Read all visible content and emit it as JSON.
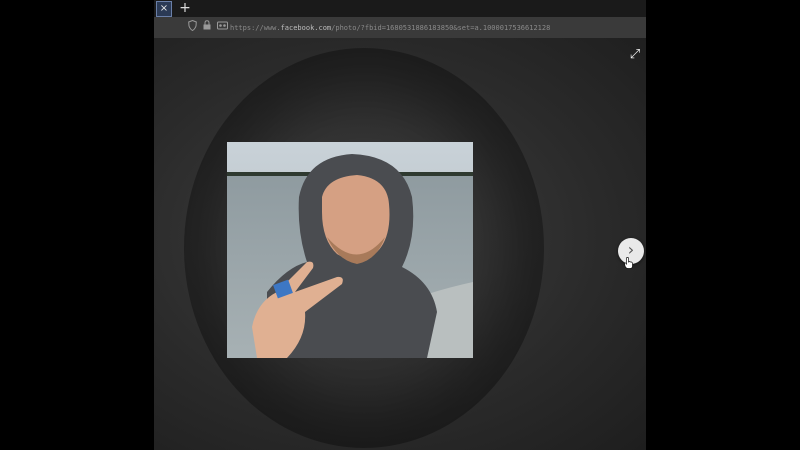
{
  "browser": {
    "tab": {
      "close_glyph": "×"
    },
    "new_tab_glyph": "+",
    "address_bar": {
      "url_prefix": "https://www.",
      "url_host": "facebook.com",
      "url_rest": "/photo/?fbid=1680531886183850&set=a.1000017536612128"
    },
    "icons": [
      "shield-icon",
      "lock-icon",
      "tracking-icon"
    ]
  },
  "viewer": {
    "expand_glyph": "⤢",
    "next_glyph": "›"
  },
  "colors": {
    "page_background": "#000000",
    "viewer_background": "#2c2c2c",
    "next_button": "#e9e9e9"
  }
}
